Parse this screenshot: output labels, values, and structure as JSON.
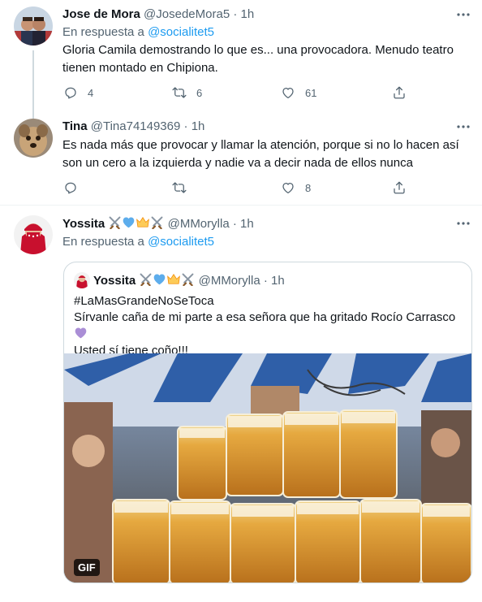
{
  "tweets": [
    {
      "name": "Jose de Mora",
      "handle": "@JosedeMora5",
      "dot": "·",
      "time": "1h",
      "reply_prefix": "En respuesta a",
      "reply_mention": "@socialitet5",
      "text": "Gloria Camila demostrando lo que es... una provocadora. Menudo teatro tienen montado en Chipiona.",
      "replies": "4",
      "retweets": "6",
      "likes": "61"
    },
    {
      "name": "Tina",
      "handle": "@Tina74149369",
      "dot": "·",
      "time": "1h",
      "text": "Es nada más que provocar y llamar la atención, porque si no lo hacen así son un cero a la izquierda y nadie va a decir nada de ellos nunca",
      "replies": "",
      "retweets": "",
      "likes": "8"
    },
    {
      "name": "Yossita",
      "handle": "@MMorylla",
      "dot": "·",
      "time": "1h",
      "reply_prefix": "En respuesta a",
      "reply_mention": "@socialitet5",
      "name_emojis": [
        "crossed-swords",
        "blue-heart",
        "crown",
        "crossed-swords"
      ]
    }
  ],
  "quote": {
    "name": "Yossita",
    "handle": "@MMorylla",
    "dot": "·",
    "time": "1h",
    "line1": "#LaMasGrandeNoSeToca",
    "line2": "Sírvanle caña de mi parte a esa señora que ha gritado Rocío Carrasco",
    "line3": "Usted sí tiene coño!!!",
    "media_badge": "GIF",
    "media_description_icon": "beer-mugs-image"
  },
  "colors": {
    "accent": "#1d9bf0",
    "secondary_text": "#536471",
    "border": "#cfd9de",
    "purple_heart": "#aa8ed6"
  }
}
